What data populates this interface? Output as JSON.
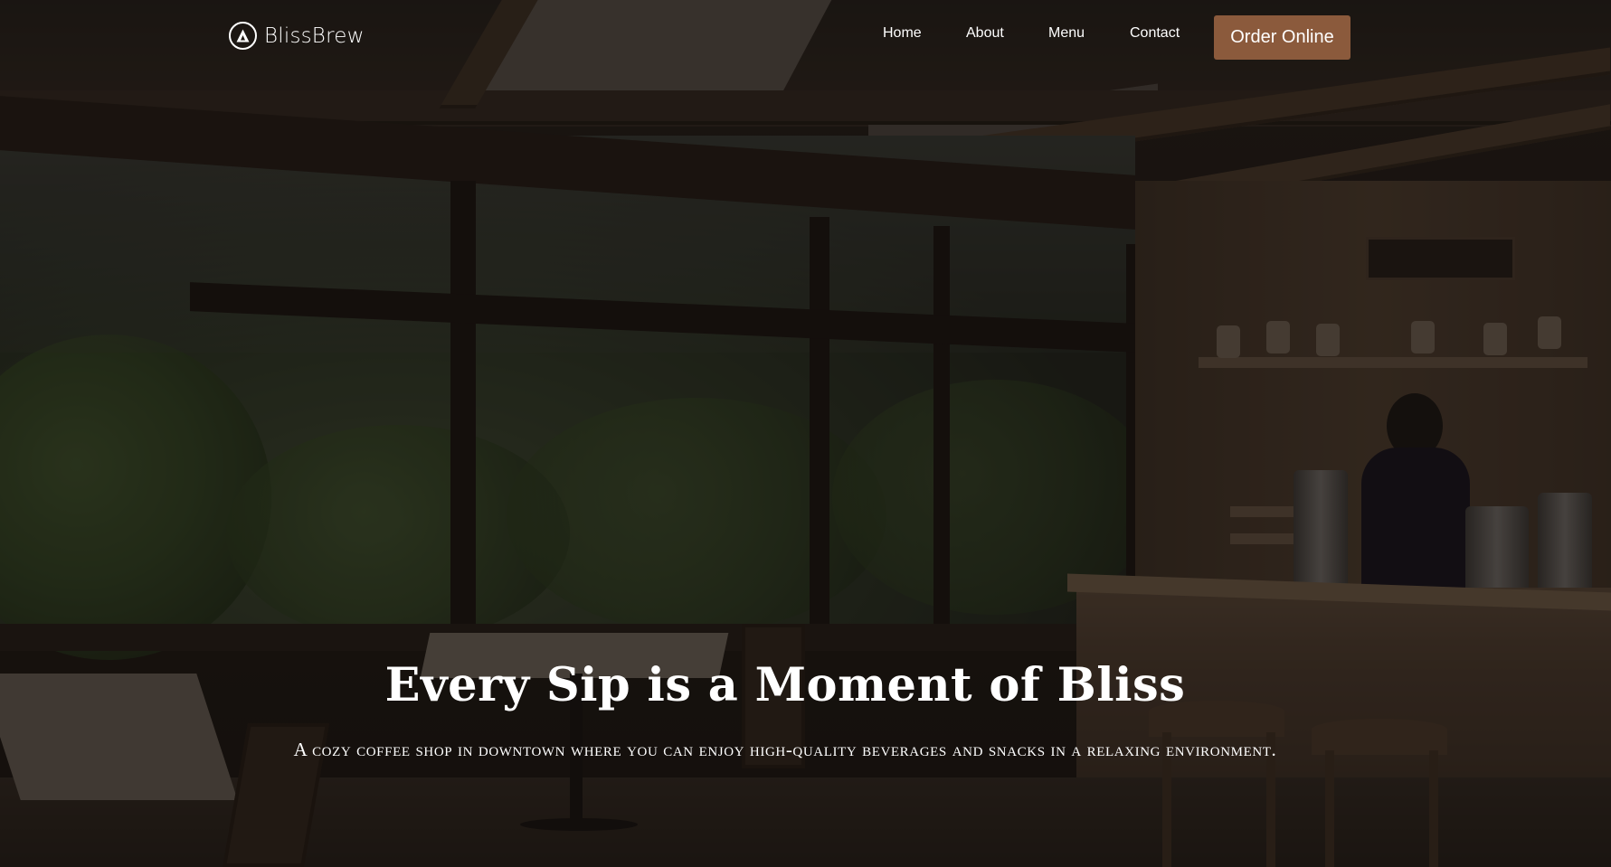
{
  "nav": {
    "brand": "BlissBrew",
    "links": {
      "home": "Home",
      "about": "About",
      "menu": "Menu",
      "contact": "Contact"
    },
    "cta_label": "Order Online"
  },
  "hero": {
    "title": "Every Sip is a Moment of Bliss",
    "subtitle": "A cozy coffee shop in downtown where you can enjoy high-quality beverages and snacks in a relaxing environment."
  },
  "icons": {
    "brand_logo": "a-triangle-circle-icon"
  },
  "colors": {
    "accent": "#8b5a3c",
    "text": "#ffffff",
    "overlay": "#0c0907"
  }
}
